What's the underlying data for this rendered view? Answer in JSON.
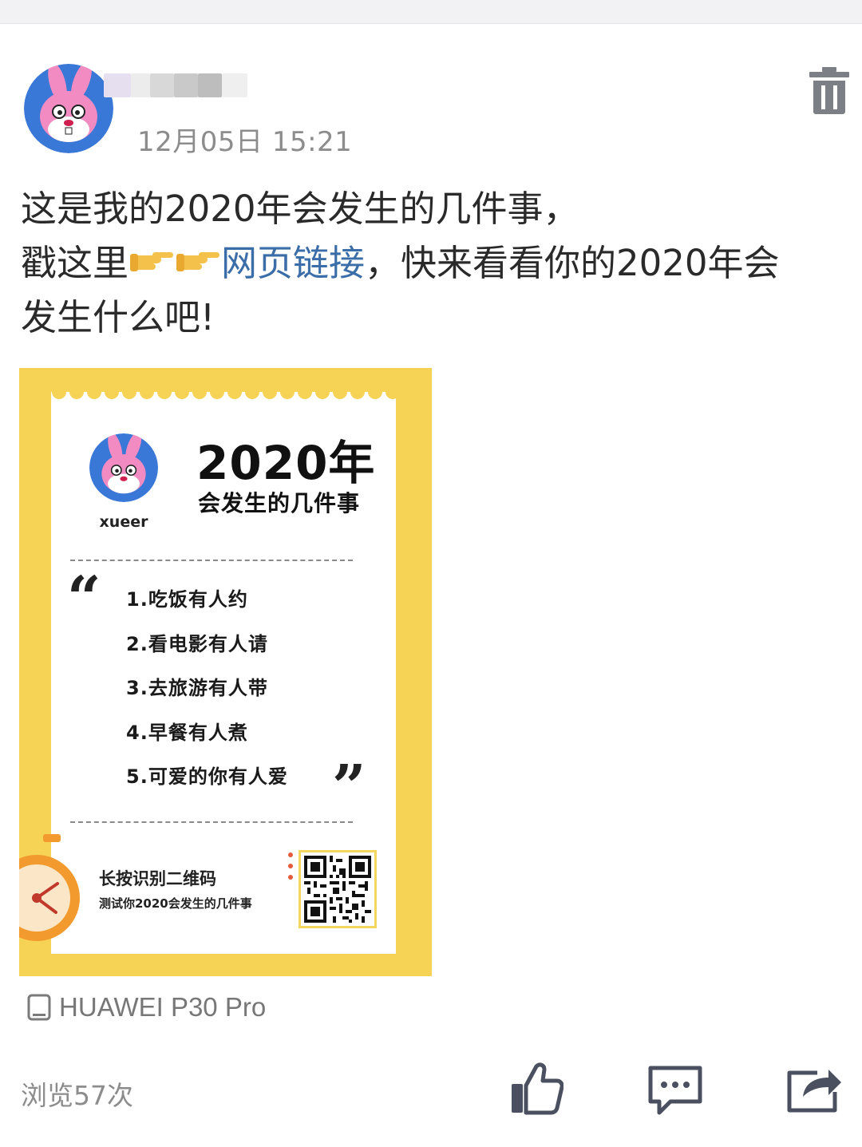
{
  "post": {
    "timestamp": "12月05日 15:21",
    "text_line1": "这是我的2020年会发生的几件事，",
    "text_line2_prefix": "戳这里",
    "link_text": "网页链接",
    "text_line2_suffix": "，快来看看你的2020年会",
    "text_line3": "发生什么吧!"
  },
  "poster": {
    "username": "xueer",
    "year_title": "2020年",
    "subtitle": "会发生的几件事",
    "items": [
      "1.吃饭有人约",
      "2.看电影有人请",
      "3.去旅游有人带",
      "4.早餐有人煮",
      "5.可爱的你有人爱"
    ],
    "scan_prompt": "长按识别二维码",
    "scan_subtext": "测试你2020会发生的几件事",
    "quote_open": "“",
    "quote_close": "”"
  },
  "footer": {
    "device": "HUAWEI P30 Pro",
    "views": "浏览57次"
  },
  "icons": {
    "delete": "trash-icon",
    "device": "phone-icon",
    "like": "thumbs-up-icon",
    "comment": "comment-icon",
    "share": "share-icon",
    "pointing_hand": "pointing-hand-icon"
  },
  "colors": {
    "link": "#3b6ea8",
    "poster_bg": "#f7d355",
    "icon": "#4a5060",
    "muted_text": "#8c8c8c"
  }
}
